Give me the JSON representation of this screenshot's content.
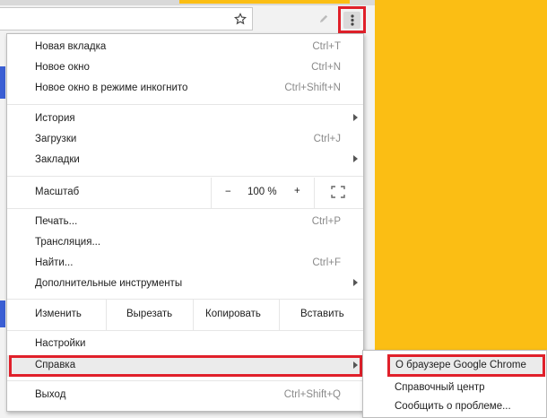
{
  "menu": {
    "items_group1": [
      {
        "label": "Новая вкладка",
        "shortcut": "Ctrl+T"
      },
      {
        "label": "Новое окно",
        "shortcut": "Ctrl+N"
      },
      {
        "label": "Новое окно в режиме инкогнито",
        "shortcut": "Ctrl+Shift+N"
      }
    ],
    "items_group2": [
      {
        "label": "История",
        "shortcut": ""
      },
      {
        "label": "Загрузки",
        "shortcut": "Ctrl+J"
      },
      {
        "label": "Закладки",
        "shortcut": ""
      }
    ],
    "zoom": {
      "label": "Масштаб",
      "minus": "−",
      "value": "100 %",
      "plus": "+"
    },
    "items_group3": [
      {
        "label": "Печать...",
        "shortcut": "Ctrl+P"
      },
      {
        "label": "Трансляция...",
        "shortcut": ""
      },
      {
        "label": "Найти...",
        "shortcut": "Ctrl+F"
      },
      {
        "label": "Дополнительные инструменты",
        "shortcut": ""
      }
    ],
    "edit": {
      "label": "Изменить",
      "cut": "Вырезать",
      "copy": "Копировать",
      "paste": "Вставить"
    },
    "settings": "Настройки",
    "help": "Справка",
    "exit": {
      "label": "Выход",
      "shortcut": "Ctrl+Shift+Q"
    }
  },
  "submenu": {
    "about": "О браузере Google Chrome",
    "help_center": "Справочный центр",
    "report": "Сообщить о проблеме..."
  },
  "colors": {
    "accent_red": "#e0202a",
    "background_yellow": "#fbbe14",
    "blue_accent": "#3b5fd4"
  },
  "icons": [
    "star-icon",
    "pencil-icon",
    "kebab-menu-icon",
    "fullscreen-icon",
    "chevron-right-icon"
  ]
}
